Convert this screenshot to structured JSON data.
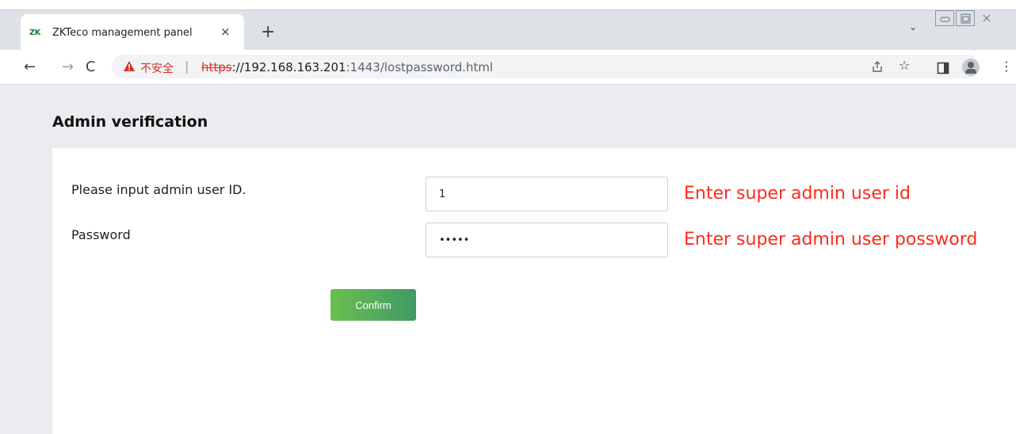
{
  "browser": {
    "tab": {
      "logo": "ZK",
      "title": "ZKTeco management panel",
      "close": "×"
    },
    "new_tab": "+",
    "tab_menu": "⌄",
    "address": {
      "security_label": "不安全",
      "separator": "|",
      "scheme": "https",
      "rest_before_port": "://192.168.163.201",
      "port_path": ":1443/lostpassword.html"
    }
  },
  "page": {
    "title": "Admin verification",
    "form": {
      "user_id_label": "Please input admin user ID.",
      "user_id_value": "1",
      "password_label": "Password",
      "password_value": "•••••",
      "confirm_label": "Confirm"
    },
    "annotations": {
      "user_id_note": "Enter super admin user id",
      "password_note": "Enter super admin user possword"
    }
  },
  "colors": {
    "annotation": "#ff2a1a",
    "confirm_button": "#4ea85d",
    "insecure": "#d93025"
  }
}
